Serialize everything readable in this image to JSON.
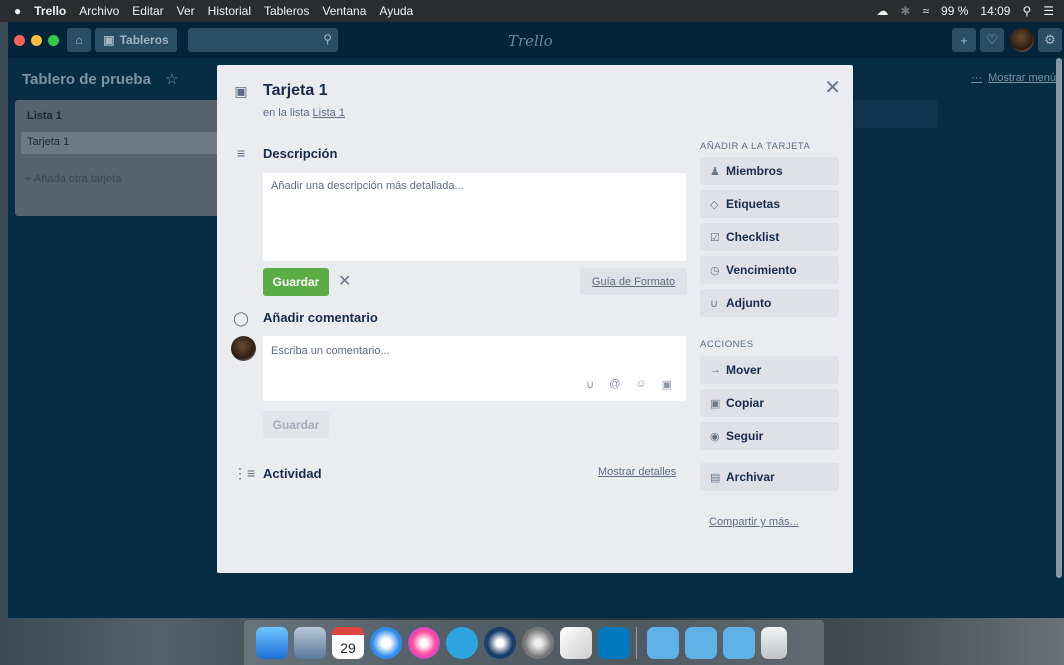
{
  "menubar": {
    "apple": "",
    "app": "Trello",
    "items": [
      "Archivo",
      "Editar",
      "Ver",
      "Historial",
      "Tableros",
      "Ventana",
      "Ayuda"
    ],
    "battery": "99 %",
    "time": "14:09"
  },
  "topbar": {
    "boards_label": "Tableros",
    "logo": "Trello"
  },
  "board": {
    "title": "Tablero de prueba",
    "show_menu": "Mostrar menú",
    "list": {
      "title": "Lista 1",
      "card": "Tarjeta 1",
      "add_card": "+ Añada otra tarjeta"
    }
  },
  "modal": {
    "title": "Tarjeta 1",
    "in_list_prefix": "en la lista",
    "in_list_link": "Lista 1",
    "description_heading": "Descripción",
    "description_placeholder": "Añadir una descripción más detallada...",
    "save_label": "Guardar",
    "format_guide": "Guía de Formato",
    "comment_heading": "Añadir comentario",
    "comment_placeholder": "Escriba un comentario...",
    "comment_save": "Guardar",
    "activity_heading": "Actividad",
    "show_details": "Mostrar detalles",
    "sidebar": {
      "add_heading": "AÑADIR A LA TARJETA",
      "add_buttons": [
        "Miembros",
        "Etiquetas",
        "Checklist",
        "Vencimiento",
        "Adjunto"
      ],
      "actions_heading": "ACCIONES",
      "action_buttons": [
        "Mover",
        "Copiar",
        "Seguir"
      ],
      "archive": "Archivar",
      "share": "Compartir y más..."
    }
  },
  "dock": {
    "calendar_day": "29"
  },
  "colors": {
    "save_green": "#5aac44",
    "board_bg": "#062d44",
    "modal_bg": "#ebecf0"
  }
}
